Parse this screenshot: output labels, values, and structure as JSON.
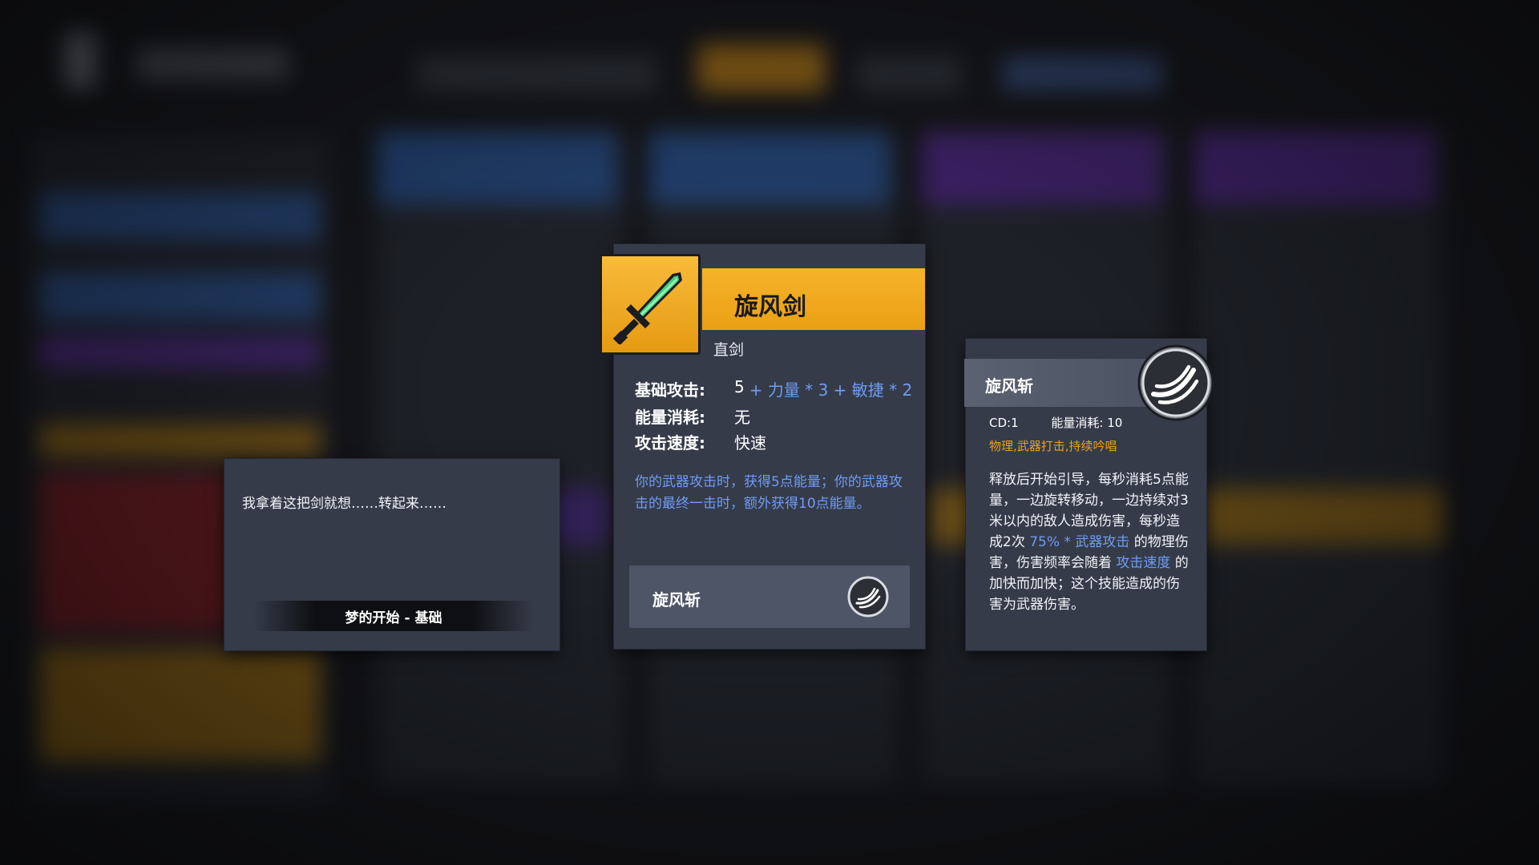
{
  "lore": {
    "text": "我拿着这把剑就想……转起来……",
    "set_name": "梦的开始 - 基础"
  },
  "weapon": {
    "name": "旋风剑",
    "type": "直剑",
    "icon": "green-sword-icon",
    "rarity_color": "#F0A31C",
    "stats": {
      "attack_label": "基础攻击:",
      "attack_base": "5",
      "attack_scaling": "+ 力量 * 3 + 敏捷 * 2",
      "energy_label": "能量消耗:",
      "energy_value": "无",
      "speed_label": "攻击速度:",
      "speed_value": "快速"
    },
    "description": "你的武器攻击时，获得5点能量；你的武器攻击的最终一击时，额外获得10点能量。",
    "skill_button_label": "旋风斩"
  },
  "skill": {
    "name": "旋风斩",
    "icon": "whirlwind-icon",
    "cd": "CD:1",
    "energy_cost": "能量消耗: 10",
    "tags": "物理,武器打击,持续吟唱",
    "desc_part1": "释放后开始引导，每秒消耗5点能量，一边旋转移动，一边持续对3米以内的敌人造成伤害，每秒造成2次 ",
    "desc_highlight1": "75% * 武器攻击",
    "desc_part2": " 的物理伤害，伤害频率会随着 ",
    "desc_highlight2": "攻击速度",
    "desc_part3": " 的加快而加快；这个技能造成的伤害为武器伤害。"
  }
}
